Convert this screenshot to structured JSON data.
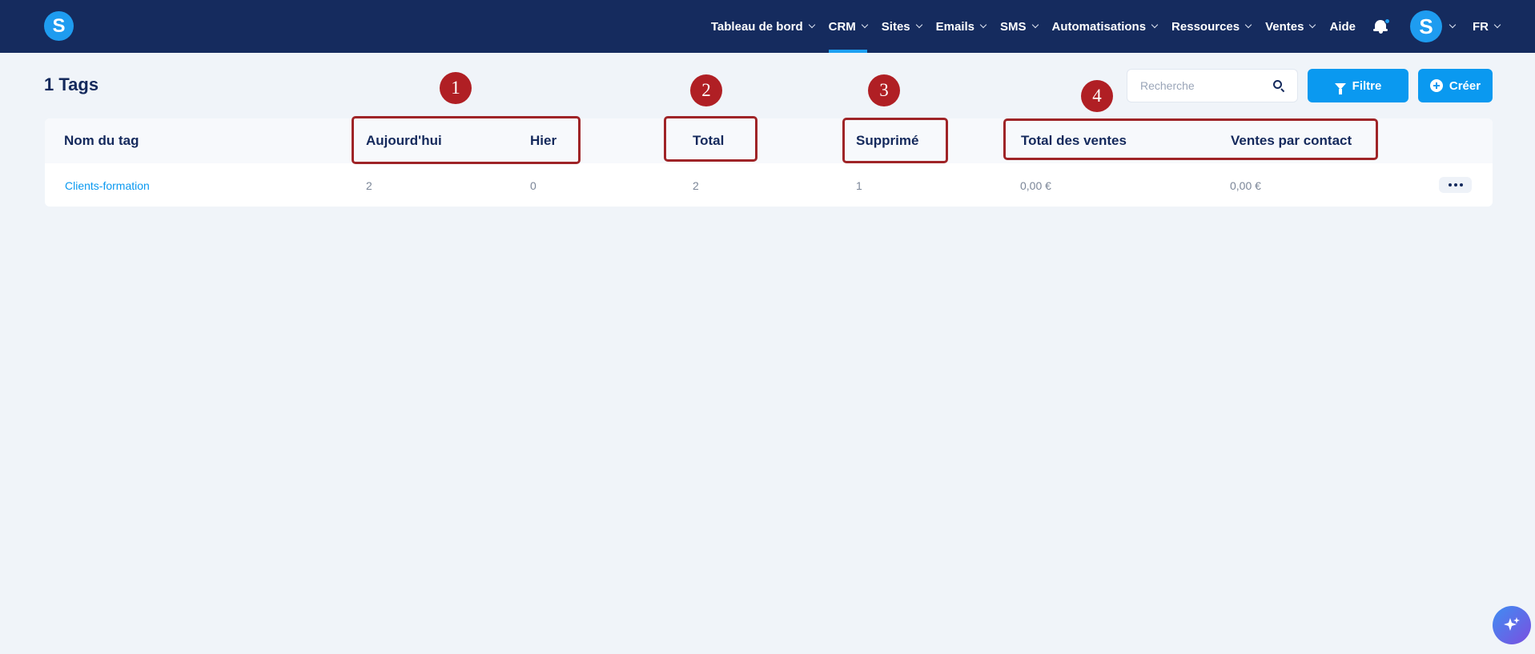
{
  "header": {
    "logo_letter": "S",
    "nav": [
      {
        "label": "Tableau de bord"
      },
      {
        "label": "CRM"
      },
      {
        "label": "Sites"
      },
      {
        "label": "Emails"
      },
      {
        "label": "SMS"
      },
      {
        "label": "Automatisations"
      },
      {
        "label": "Ressources"
      },
      {
        "label": "Ventes"
      }
    ],
    "active_nav": "CRM",
    "help_label": "Aide",
    "avatar_letter": "S",
    "language": "FR"
  },
  "page": {
    "title": "1 Tags",
    "search_placeholder": "Recherche",
    "filter_label": "Filtre",
    "create_label": "Créer"
  },
  "table": {
    "columns": [
      "Nom du tag",
      "Aujourd'hui",
      "Hier",
      "Total",
      "Supprimé",
      "Total des ventes",
      "Ventes par contact"
    ],
    "rows": [
      {
        "name": "Clients-formation",
        "today": "2",
        "yesterday": "0",
        "total": "2",
        "deleted": "1",
        "total_sales": "0,00 €",
        "sales_per_contact": "0,00 €"
      }
    ]
  },
  "annotations": [
    "1",
    "2",
    "3",
    "4"
  ],
  "colors": {
    "nav_bg": "#152b5e",
    "accent": "#0a99f0",
    "annotation": "#b01f24",
    "page_bg": "#f0f4f9"
  }
}
